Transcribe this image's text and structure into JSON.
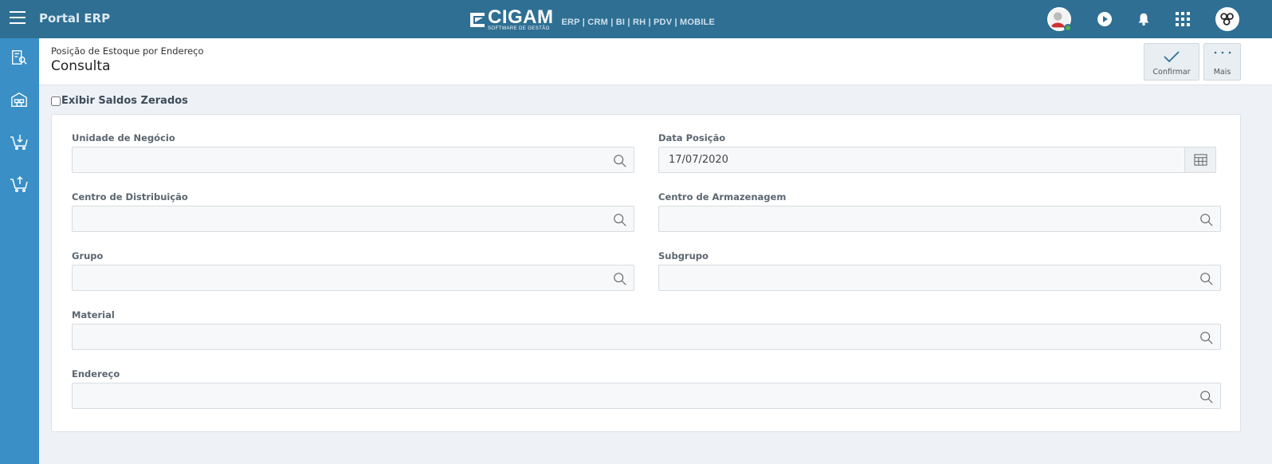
{
  "topbar": {
    "app_title": "Portal ERP",
    "brand_name": "CIGAM",
    "brand_sub": "SOFTWARE DE GESTÃO",
    "brand_modules": "ERP | CRM | BI | RH | PDV | MOBILE"
  },
  "header": {
    "breadcrumb": "Posição de Estoque por Endereço",
    "title": "Consulta",
    "actions": {
      "confirm_label": "Confirmar",
      "more_label": "Mais"
    }
  },
  "options": {
    "show_zero_balances_label": "Exibir Saldos Zerados",
    "show_zero_balances_checked": false
  },
  "form": {
    "business_unit": {
      "label": "Unidade de Negócio",
      "value": ""
    },
    "position_date": {
      "label": "Data Posição",
      "value": "17/07/2020"
    },
    "distribution_center": {
      "label": "Centro de Distribuição",
      "value": ""
    },
    "storage_center": {
      "label": "Centro de Armazenagem",
      "value": ""
    },
    "group": {
      "label": "Grupo",
      "value": ""
    },
    "subgroup": {
      "label": "Subgrupo",
      "value": ""
    },
    "material": {
      "label": "Material",
      "value": ""
    },
    "address": {
      "label": "Endereço",
      "value": ""
    }
  },
  "colors": {
    "topbar": "#2e6f93",
    "sidebar": "#3a8fc6",
    "background": "#eef2f7"
  },
  "icons": {
    "sidebar": [
      "inventory-search-icon",
      "warehouse-icon",
      "cart-download-icon",
      "cart-upload-icon"
    ],
    "topbar": [
      "menu-icon",
      "user-avatar",
      "play-icon",
      "bell-icon",
      "apps-grid-icon",
      "company-avatar"
    ]
  }
}
